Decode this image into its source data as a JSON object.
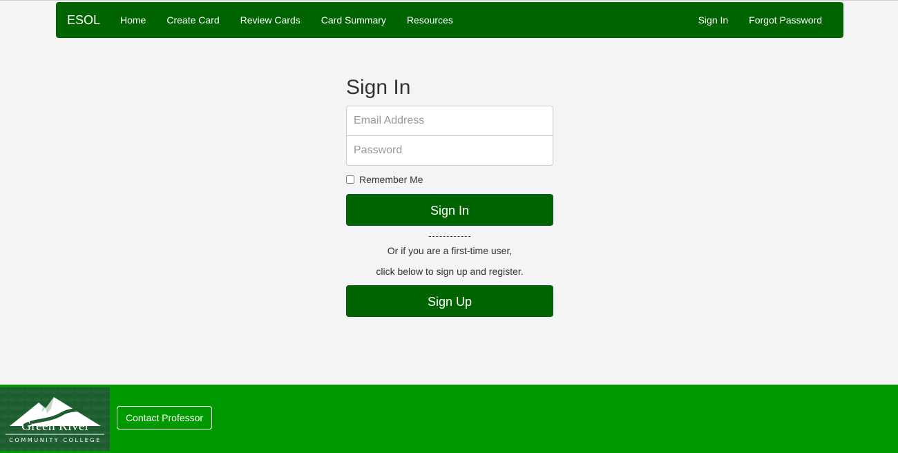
{
  "navbar": {
    "brand": "ESOL",
    "left_items": [
      "Home",
      "Create Card",
      "Review Cards",
      "Card Summary",
      "Resources"
    ],
    "right_items": [
      "Sign In",
      "Forgot Password"
    ]
  },
  "signin": {
    "title": "Sign In",
    "email_placeholder": "Email Address",
    "email_value": "",
    "password_placeholder": "Password",
    "password_value": "",
    "remember_label": "Remember Me",
    "remember_checked": false,
    "submit_label": "Sign In",
    "note_line1": "Or if you are a first-time user,",
    "note_line2": "click below to sign up and register.",
    "signup_label": "Sign Up"
  },
  "footer": {
    "logo_name": "Green River",
    "logo_sub": "COMMUNITY COLLEGE",
    "contact_label": "Contact Professor"
  },
  "colors": {
    "navbar_bg": "#006400",
    "footer_bg": "#009900",
    "button_bg": "#006400",
    "page_bg": "#f4f4f4"
  }
}
